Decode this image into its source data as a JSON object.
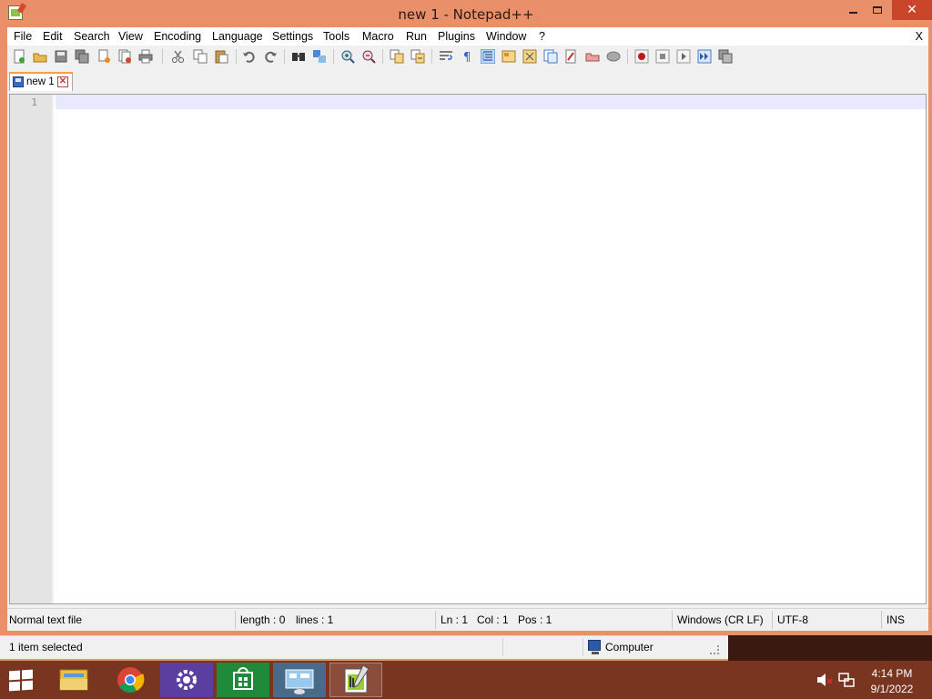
{
  "window": {
    "title": "new 1 - Notepad++",
    "close_glyph": "✕"
  },
  "menu": {
    "items": [
      "File",
      "Edit",
      "Search",
      "View",
      "Encoding",
      "Language",
      "Settings",
      "Tools",
      "Macro",
      "Run",
      "Plugins",
      "Window",
      "?"
    ],
    "close": "X"
  },
  "toolbar": {
    "icons": [
      "new-file-icon",
      "open-file-icon",
      "save-icon",
      "save-all-icon",
      "close-icon",
      "close-all-icon",
      "print-icon",
      "cut-icon",
      "copy-icon",
      "paste-icon",
      "undo-icon",
      "redo-icon",
      "find-icon",
      "replace-icon",
      "zoom-in-icon",
      "zoom-out-icon",
      "sync-vertical-icon",
      "sync-horizontal-icon",
      "word-wrap-icon",
      "show-all-chars-icon",
      "indent-guide-icon",
      "user-language-icon",
      "doc-map-icon",
      "function-list-icon",
      "folder-workspace-icon",
      "monitoring-icon",
      "record-macro-icon",
      "stop-macro-icon",
      "play-macro-icon",
      "run-macro-multiple-icon",
      "save-macro-icon"
    ]
  },
  "tabs": [
    {
      "label": "new 1",
      "close_glyph": "✕"
    }
  ],
  "editor": {
    "line_numbers": [
      "1"
    ],
    "content": ""
  },
  "statusbar": {
    "file_type": "Normal text file",
    "length": "length : 0",
    "lines": "lines : 1",
    "ln": "Ln : 1",
    "col": "Col : 1",
    "pos": "Pos : 1",
    "eol": "Windows (CR LF)",
    "encoding": "UTF-8",
    "mode": "INS"
  },
  "explorer": {
    "selection": "1 item selected",
    "location": "Computer"
  },
  "taskbar": {
    "apps": [
      "file-explorer-icon",
      "chrome-icon",
      "settings-icon",
      "store-icon",
      "control-panel-icon",
      "notepadpp-icon"
    ],
    "time": "4:14 PM",
    "date": "9/1/2022"
  },
  "colors": {
    "accent": "#e9906a",
    "taskbar": "#7a3520",
    "current_line": "#e8e8ff",
    "gutter": "#e4e4e4",
    "tab_active_border": "#f3a23a"
  }
}
